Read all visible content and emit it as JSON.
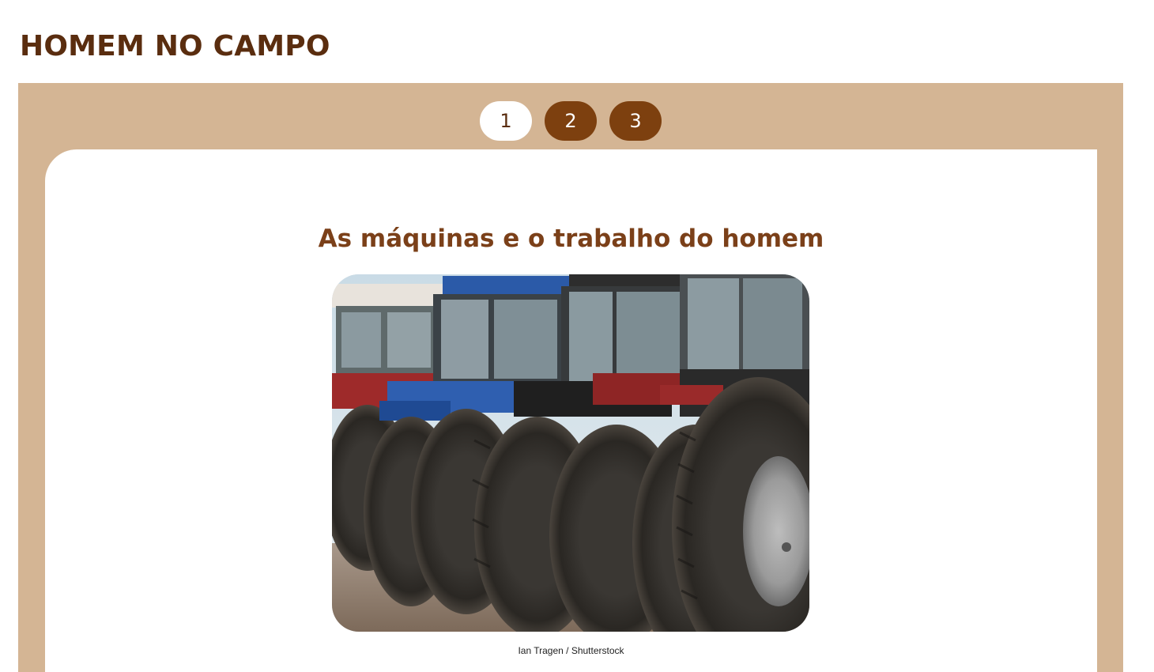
{
  "header": {
    "title": "HOMEM NO CAMPO"
  },
  "pagination": {
    "pages": [
      "1",
      "2",
      "3"
    ],
    "active_index": 0
  },
  "content": {
    "heading": "As máquinas e o trabalho do homem",
    "image_alt": "tractor-row-photo",
    "credit": "Ian Tragen / Shutterstock"
  },
  "colors": {
    "title": "#5a2d0f",
    "frame": "#d4b594",
    "pager_inactive": "#7d400f",
    "heading": "#7b4019"
  }
}
